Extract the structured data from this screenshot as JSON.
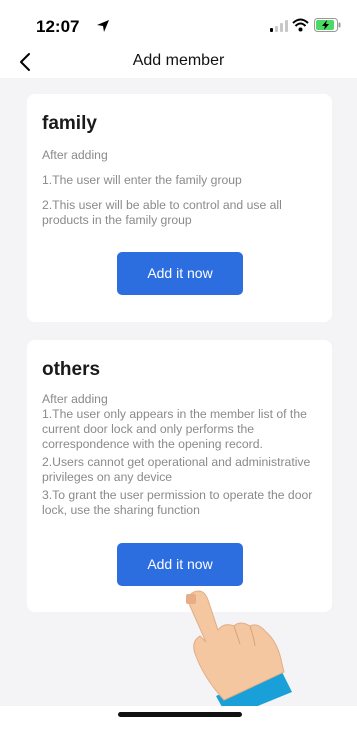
{
  "status_bar": {
    "time": "12:07",
    "icons": [
      "location-arrow-icon",
      "signal-icon",
      "wifi-icon",
      "battery-charging-icon"
    ]
  },
  "nav": {
    "back_icon": "chevron-left-icon",
    "title": "Add member"
  },
  "family_card": {
    "title": "family",
    "lines": [
      "After adding",
      "1.The user will enter the family group",
      "2.This user will be able to control and use all products in the family group"
    ],
    "button_label": "Add it now"
  },
  "others_card": {
    "title": "others",
    "lines": [
      "After adding",
      "1.The user only appears in the member list of the current door lock and only performs the correspondence with the opening record.",
      "2.Users cannot get operational and administrative privileges on any device",
      "3.To grant the user permission to operate the door lock, use the sharing function"
    ],
    "button_label": "Add it now"
  },
  "overlay": {
    "icon": "pointing-hand-icon"
  },
  "colors": {
    "accent": "#2c6de0",
    "background": "#f4f4f6",
    "card": "#ffffff",
    "secondary_text": "#8a8a8a",
    "battery": "#4cd964"
  }
}
